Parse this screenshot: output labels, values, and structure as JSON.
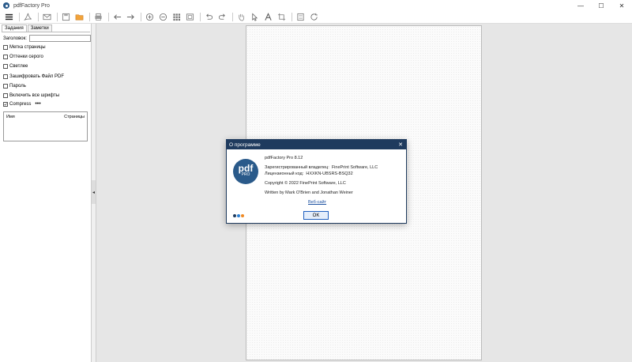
{
  "window": {
    "title": "pdfFactory Pro",
    "minimize": "—",
    "maximize": "☐",
    "close": "✕"
  },
  "toolbar": {
    "buttons": [
      "menu-icon",
      "pdf-icon",
      "mail-icon",
      "save-icon",
      "open-folder-icon",
      "print-icon",
      "back-icon",
      "forward-icon",
      "zoom-in-icon",
      "zoom-out-icon",
      "grid-icon",
      "fit-icon",
      "undo-icon",
      "redo-icon",
      "hand-icon",
      "pointer-icon",
      "text-icon",
      "crop-icon",
      "page-icon",
      "refresh-icon"
    ]
  },
  "left_panel": {
    "tabs": [
      "Задания",
      "Заметки"
    ],
    "heading_label": "Заголовок:",
    "heading_value": "",
    "options": [
      {
        "label": "Метка страницы",
        "checked": false
      },
      {
        "label": "Оттенки серого",
        "checked": false
      },
      {
        "label": "Светлее",
        "checked": false
      },
      {
        "label": "Зашифровать Файл PDF",
        "checked": false
      },
      {
        "label": "Пароль",
        "checked": false
      },
      {
        "label": "Включить все шрифты",
        "checked": false
      },
      {
        "label": "Compress",
        "checked": true
      }
    ],
    "more_label": "•••",
    "table_headers": {
      "name": "Имя",
      "pages": "Страницы"
    }
  },
  "dialog": {
    "title": "О программе",
    "close": "✕",
    "logo_text": "pdf",
    "logo_sub": "PRO",
    "product": "pdfFactory Pro 8.12",
    "owner_label": "Зарегистрированный владелец:",
    "owner_value": "FinePrint Software, LLC",
    "license_label": "Лицензионный код:",
    "license_value": "HXXKN-UBSRS-BSQ32",
    "copyright": "Copyright © 2022 FinePrint Software, LLC",
    "authors": "Written by Mark O'Brien and Jonathan Weiner",
    "website": "Веб-сайт",
    "ok": "OK",
    "dot_colors": [
      "#1f3b5e",
      "#2a7fd4",
      "#f08a24"
    ]
  },
  "splitter_arrow": "◂"
}
